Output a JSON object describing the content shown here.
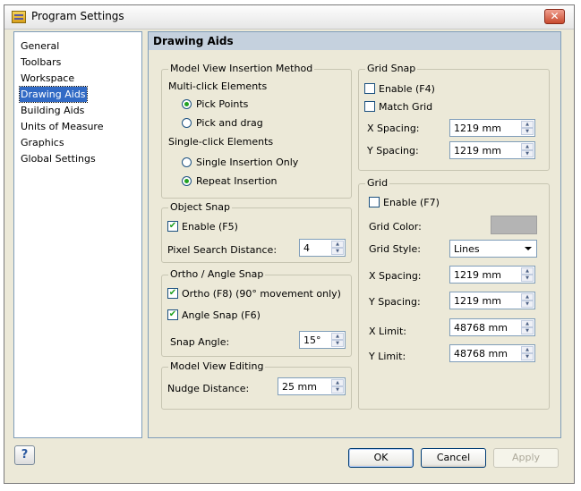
{
  "window": {
    "title": "Program Settings",
    "close_glyph": "✕"
  },
  "sidebar": {
    "items": [
      {
        "label": "General"
      },
      {
        "label": "Toolbars"
      },
      {
        "label": "Workspace"
      },
      {
        "label": "Drawing Aids",
        "selected": true
      },
      {
        "label": "Building Aids"
      },
      {
        "label": "Units of Measure"
      },
      {
        "label": "Graphics"
      },
      {
        "label": "Global Settings"
      }
    ]
  },
  "panel": {
    "title": "Drawing Aids"
  },
  "insertion": {
    "title": "Model View Insertion Method",
    "multi_label": "Multi-click Elements",
    "pick_points": "Pick Points",
    "pick_drag": "Pick and drag",
    "single_label": "Single-click Elements",
    "single_only": "Single Insertion Only",
    "repeat": "Repeat Insertion"
  },
  "object_snap": {
    "title": "Object Snap",
    "enable": "Enable (F5)",
    "pixel_label": "Pixel Search Distance:",
    "pixel_value": "4"
  },
  "ortho": {
    "title": "Ortho / Angle Snap",
    "ortho": "Ortho (F8) (90° movement only)",
    "angle": "Angle Snap (F6)",
    "snap_label": "Snap Angle:",
    "snap_value": "15°"
  },
  "editing": {
    "title": "Model View Editing",
    "nudge_label": "Nudge Distance:",
    "nudge_value": "25 mm"
  },
  "grid_snap": {
    "title": "Grid Snap",
    "enable": "Enable (F4)",
    "match": "Match Grid",
    "x_label": "X Spacing:",
    "x_value": "1219 mm",
    "y_label": "Y Spacing:",
    "y_value": "1219 mm"
  },
  "grid": {
    "title": "Grid",
    "enable": "Enable (F7)",
    "color_label": "Grid Color:",
    "color": "#b4b4b4",
    "style_label": "Grid Style:",
    "style_value": "Lines",
    "x_label": "X Spacing:",
    "x_value": "1219 mm",
    "y_label": "Y Spacing:",
    "y_value": "1219 mm",
    "xlimit_label": "X Limit:",
    "xlimit_value": "48768 mm",
    "ylimit_label": "Y Limit:",
    "ylimit_value": "48768 mm"
  },
  "footer": {
    "help": "?",
    "ok": "OK",
    "cancel": "Cancel",
    "apply": "Apply"
  }
}
